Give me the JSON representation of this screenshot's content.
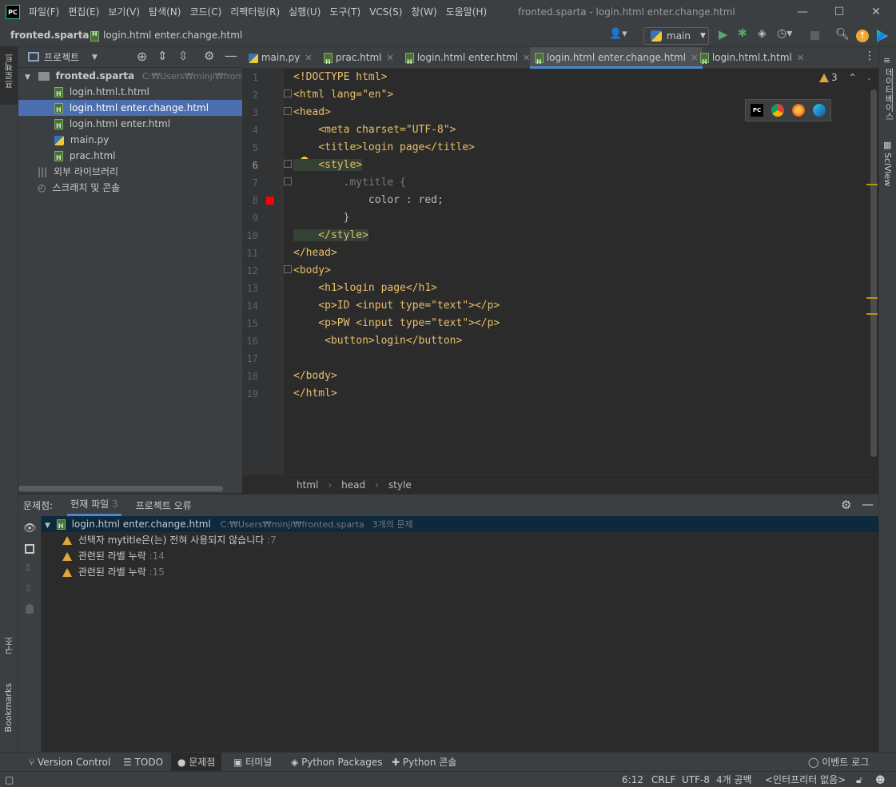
{
  "app": {
    "logo_text": "PC"
  },
  "window": {
    "title": "fronted.sparta - login.html enter.change.html"
  },
  "menu": [
    "파일(F)",
    "편집(E)",
    "보기(V)",
    "탐색(N)",
    "코드(C)",
    "리팩터링(R)",
    "실행(U)",
    "도구(T)",
    "VCS(S)",
    "창(W)",
    "도움말(H)"
  ],
  "navbar": {
    "project": "fronted.sparta",
    "file": "login.html enter.change.html",
    "run_config": "main"
  },
  "left_stripe": {
    "project": "프로젝트",
    "structure": "구조",
    "bookmarks": "Bookmarks"
  },
  "right_stripe": {
    "database": "데이터베이스",
    "sciview": "SciView"
  },
  "project_panel": {
    "title": "프로젝트",
    "root": {
      "name": "fronted.sparta",
      "path": "C:₩Users₩minji₩fronted.sp"
    },
    "files": [
      "login.html.t.html",
      "login.html enter.change.html",
      "login.html enter.html",
      "main.py",
      "prac.html"
    ],
    "external_libs": "외부 라이브러리",
    "scratches": "스크래치 및 콘솔"
  },
  "tabs": [
    "main.py",
    "prac.html",
    "login.html enter.html",
    "login.html enter.change.html",
    "login.html.t.html"
  ],
  "editor": {
    "line_numbers": [
      "1",
      "2",
      "3",
      "4",
      "5",
      "6",
      "7",
      "8",
      "9",
      "10",
      "11",
      "12",
      "13",
      "14",
      "15",
      "16",
      "17",
      "18",
      "19"
    ],
    "warning_count": "3",
    "lines": [
      "<!DOCTYPE html>",
      "<html lang=\"en\">",
      "<head>",
      "    <meta charset=\"UTF-8\">",
      "    <title>login page</title>",
      "    <style>",
      "        .mytitle {",
      "            color : red;",
      "        }",
      "    </style>",
      "</head>",
      "<body>",
      "    <h1>login page</h1>",
      "    <p>ID <input type=\"text\"></p>",
      "    <p>PW <input type=\"text\"></p>",
      "     <button>login</button>",
      "",
      "</body>",
      "</html>"
    ],
    "breadcrumb": [
      "html",
      "head",
      "style"
    ]
  },
  "problems": {
    "label": "문제점:",
    "tab_current": "현재 파일",
    "tab_current_count": "3",
    "tab_project": "프로젝트 오류",
    "file": {
      "name": "login.html enter.change.html",
      "path": "C:₩Users₩minji₩fronted.sparta",
      "count": "3개의 문제"
    },
    "items": [
      {
        "text": "선택자 mytitle은(는) 전혀 사용되지 않습니다",
        "line": ":7"
      },
      {
        "text": "관련된 라벨 누락",
        "line": ":14"
      },
      {
        "text": "관련된 라벨 누락",
        "line": ":15"
      }
    ]
  },
  "tool_windows": [
    "Version Control",
    "TODO",
    "문제점",
    "터미널",
    "Python Packages",
    "Python 콘솔"
  ],
  "event_log": "이벤트 로그",
  "status": {
    "position": "6:12",
    "line_sep": "CRLF",
    "encoding": "UTF-8",
    "indent": "4개 공백",
    "interpreter": "<인터프리터 없음>"
  }
}
